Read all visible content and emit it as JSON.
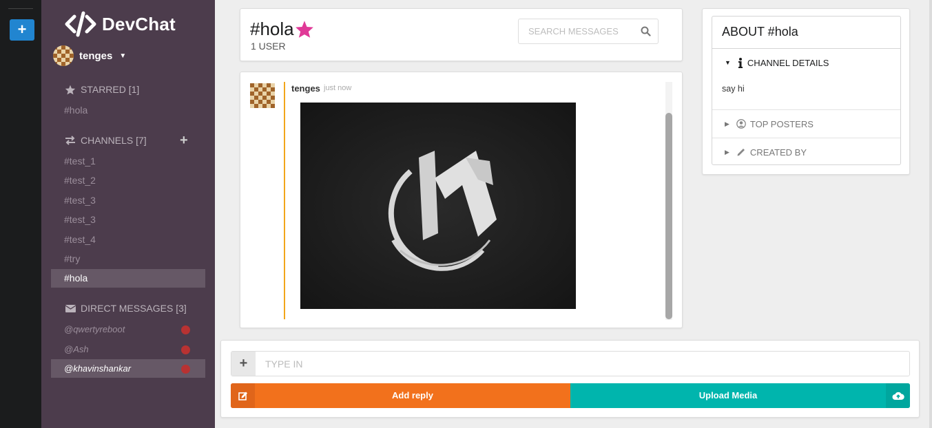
{
  "app": {
    "name": "DevChat",
    "add_label": "+"
  },
  "user": {
    "name": "tenges"
  },
  "sidebar": {
    "starred": {
      "label": "STARRED [1]",
      "items": [
        "#hola"
      ]
    },
    "channels": {
      "label": "CHANNELS [7]",
      "items": [
        "#test_1",
        "#test_2",
        "#test_3",
        "#test_3",
        "#test_4",
        "#try",
        "#hola"
      ],
      "active": "#hola"
    },
    "direct": {
      "label": "DIRECT MESSAGES [3]",
      "items": [
        "@qwertyreboot",
        "@Ash",
        "@khavinshankar"
      ]
    }
  },
  "channel": {
    "name": "#hola",
    "users": "1 USER",
    "star_color": "#e03997"
  },
  "search": {
    "placeholder": "SEARCH MESSAGES"
  },
  "message": {
    "author": "tenges",
    "time": "just now"
  },
  "about": {
    "title": "ABOUT #hola",
    "details_label": "CHANNEL DETAILS",
    "details_text": "say hi",
    "top_posters_label": "TOP POSTERS",
    "created_by_label": "CREATED BY"
  },
  "compose": {
    "placeholder": "TYPE IN",
    "add_reply_label": "Add reply",
    "upload_label": "Upload Media"
  },
  "colors": {
    "sidebar": "#4c3c4c",
    "reply": "#f2711c",
    "upload": "#00b5ad",
    "accent_bar": "#f2a51a",
    "dm_dot": "#b83232"
  }
}
